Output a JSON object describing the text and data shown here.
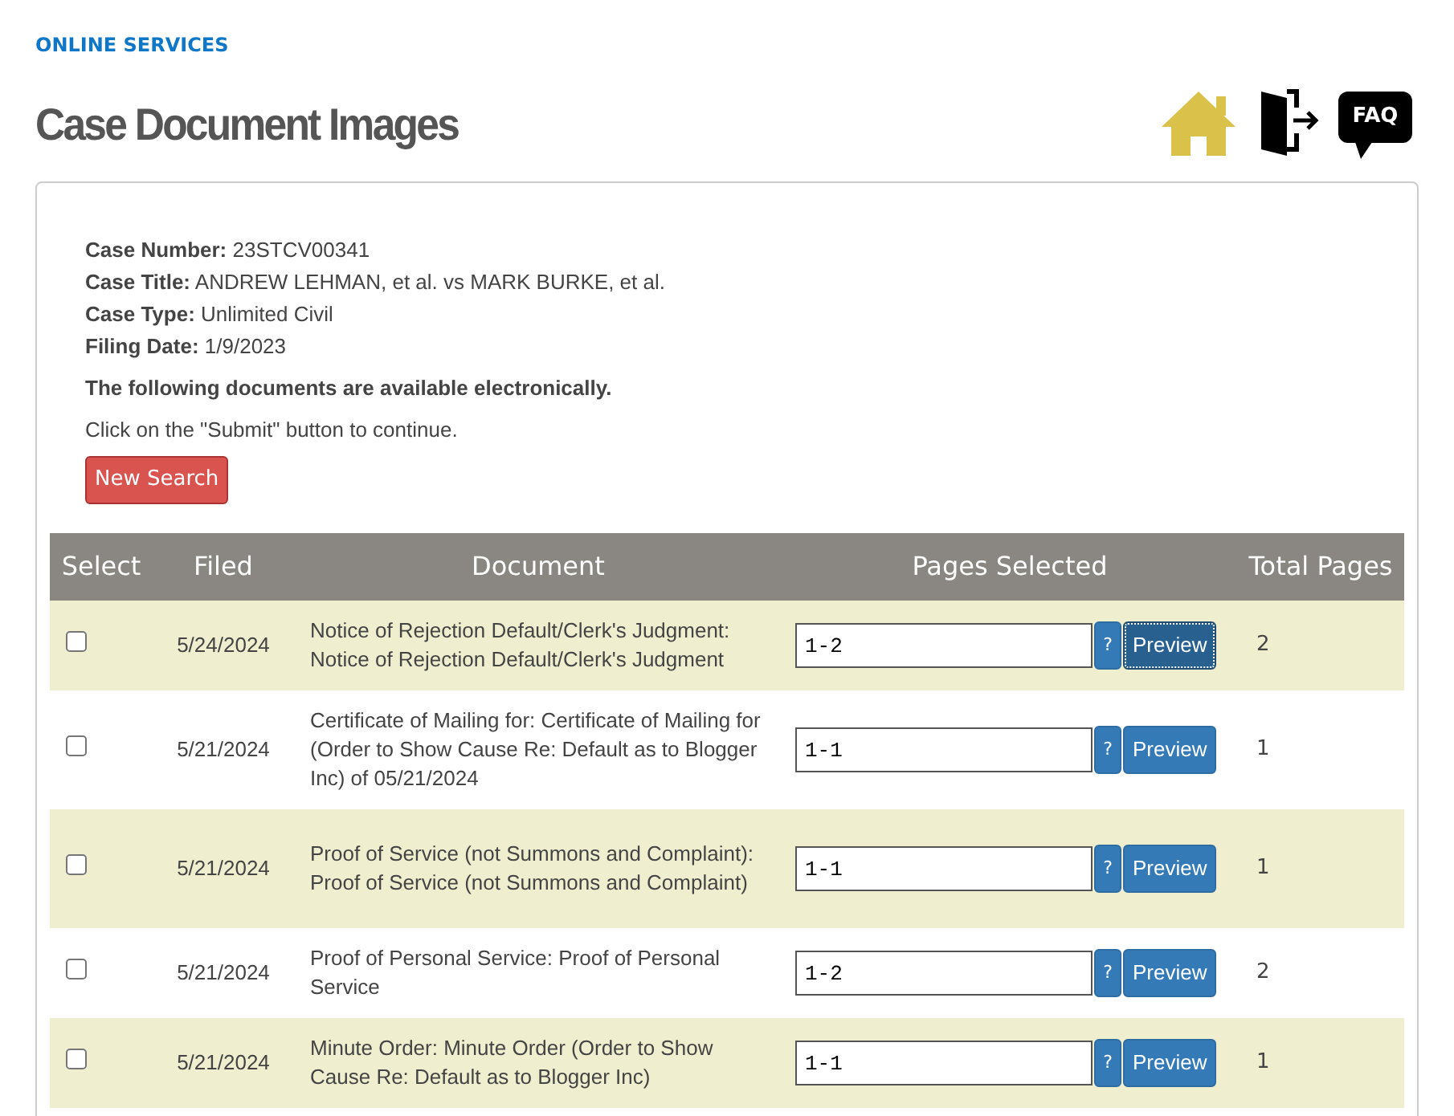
{
  "breadcrumb": "ONLINE SERVICES",
  "title": "Case Document Images",
  "header_icons": [
    {
      "kind": "home"
    },
    {
      "kind": "exit"
    },
    {
      "kind": "faq",
      "label": "FAQ"
    }
  ],
  "case_info": [
    {
      "label": "Case Number:",
      "value": "23STCV00341"
    },
    {
      "label": "Case Title:",
      "value": "ANDREW LEHMAN, et al. vs MARK BURKE, et al."
    },
    {
      "label": "Case Type:",
      "value": "Unlimited Civil"
    },
    {
      "label": "Filing Date:",
      "value": "1/9/2023"
    }
  ],
  "notice": "The following documents are available electronically.",
  "instruction": "Click on the \"Submit\" button to continue.",
  "new_search_button": "New Search",
  "table": {
    "columns": [
      "Select",
      "Filed",
      "Document",
      "Pages Selected",
      "Total Pages"
    ],
    "rows": [
      {
        "checked": false,
        "filed": "5/24/2024",
        "document": "Notice of Rejection Default/Clerk's Judgment: Notice of Rejection Default/Clerk's Judgment",
        "pages": "1-2",
        "help": "?",
        "preview": "Preview",
        "focused": true,
        "total": "2"
      },
      {
        "checked": false,
        "filed": "5/21/2024",
        "document": "Certificate of Mailing for: Certificate of Mailing for (Order to Show Cause Re: Default as to Blogger Inc) of 05/21/2024",
        "pages": "1-1",
        "help": "?",
        "preview": "Preview",
        "focused": false,
        "total": "1"
      },
      {
        "checked": false,
        "filed": "5/21/2024",
        "document": "Proof of Service (not Summons and Complaint): Proof of Service (not Summons and Complaint)",
        "pages": "1-1",
        "help": "?",
        "preview": "Preview",
        "focused": false,
        "total": "1"
      },
      {
        "checked": false,
        "filed": "5/21/2024",
        "document": "Proof of Personal Service: Proof of Personal Service",
        "pages": "1-2",
        "help": "?",
        "preview": "Preview",
        "focused": false,
        "total": "2"
      },
      {
        "checked": false,
        "filed": "5/21/2024",
        "document": "Minute Order: Minute Order (Order to Show Cause Re: Default as to Blogger Inc)",
        "pages": "1-1",
        "help": "?",
        "preview": "Preview",
        "focused": false,
        "total": "1"
      }
    ]
  }
}
